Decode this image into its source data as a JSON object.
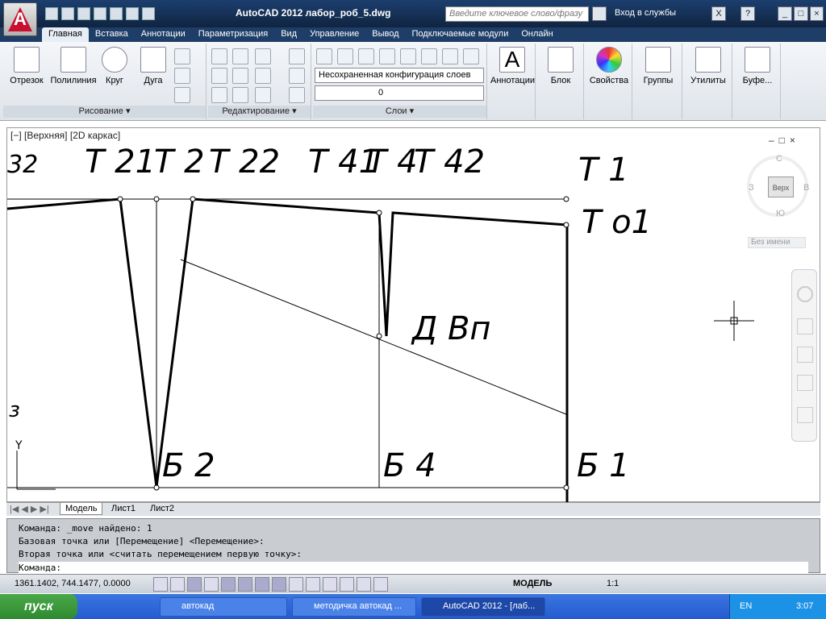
{
  "window": {
    "title": "AutoCAD 2012    лабор_роб_5.dwg",
    "search_placeholder": "Введите ключевое слово/фразу",
    "login": "Вход в службы",
    "help": "?",
    "app_letter": "A"
  },
  "ribbon_tabs": [
    "Главная",
    "Вставка",
    "Аннотации",
    "Параметризация",
    "Вид",
    "Управление",
    "Вывод",
    "Подключаемые модули",
    "Онлайн"
  ],
  "draw_panel": {
    "title": "Рисование ▾",
    "tools": [
      "Отрезок",
      "Полилиния",
      "Круг",
      "Дуга"
    ]
  },
  "modify_panel": {
    "title": "Редактирование ▾"
  },
  "layers_panel": {
    "title": "Слои ▾",
    "config": "Несохраненная конфигурация слоев",
    "current": "0"
  },
  "big_buttons": [
    "Аннотации",
    "Блок",
    "Свойства",
    "Группы",
    "Утилиты",
    "Буфе..."
  ],
  "viewport": {
    "label": "[−] [Верхняя] [2D каркас]",
    "wcs": "Без имени"
  },
  "viewcube": {
    "top": "Верх",
    "n": "С",
    "s": "Ю",
    "w": "З",
    "e": "В"
  },
  "drawing_labels": {
    "t32": "32",
    "t21": "Т 21",
    "t2": "Т 2",
    "t22": "Т 22",
    "t41": "Т 41",
    "t4": "Т 4",
    "t42": "Т 42",
    "t1": "Т 1",
    "to1": "Т о1",
    "dvp": "Д Вп",
    "b2": "Б 2",
    "b4": "Б 4",
    "b1": "Б 1",
    "z": "з",
    "y": "Y"
  },
  "layout_tabs": [
    "Модель",
    "Лист1",
    "Лист2"
  ],
  "command_lines": [
    "Команда: _move найдено: 1",
    "Базовая точка или [Перемещение] <Перемещение>:",
    "Вторая точка или <считать перемещением первую точку>:",
    "Команда:"
  ],
  "status": {
    "coords": "1361.1402, 744.1477, 0.0000",
    "model": "МОДЕЛЬ",
    "scale": "1:1"
  },
  "taskbar": {
    "start": "пуск",
    "tasks": [
      "автокад",
      "методичка автокад ...",
      "AutoCAD 2012 - [лаб..."
    ],
    "lang": "EN",
    "clock": "3:07"
  }
}
